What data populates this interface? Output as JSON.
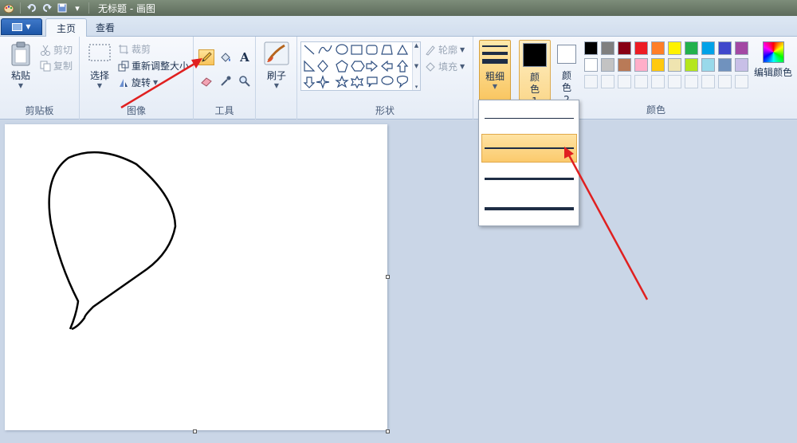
{
  "window": {
    "title": "无标题 - 画图"
  },
  "tabs": {
    "home": "主页",
    "view": "查看"
  },
  "ribbon": {
    "clipboard": {
      "label": "剪贴板",
      "paste": "粘贴",
      "cut": "剪切",
      "copy": "复制"
    },
    "image": {
      "label": "图像",
      "select": "选择",
      "crop": "裁剪",
      "resize": "重新调整大小",
      "rotate": "旋转"
    },
    "tools": {
      "label": "工具",
      "active": "pencil"
    },
    "brushes": {
      "label": "刷子"
    },
    "shapes": {
      "label": "形状",
      "outline": "轮廓",
      "fill": "填充"
    },
    "size": {
      "label": "粗细"
    },
    "colors": {
      "label": "颜色",
      "color1_label": "颜色 1",
      "color2_label": "颜色 2",
      "color1_value": "#000000",
      "color2_value": "#ffffff",
      "edit_label": "编辑颜色",
      "palette_row1": [
        "#000000",
        "#7f7f7f",
        "#880015",
        "#ed1c24",
        "#ff7f27",
        "#fff200",
        "#22b14c",
        "#00a2e8",
        "#3f48cc",
        "#a349a4"
      ],
      "palette_row2": [
        "#ffffff",
        "#c3c3c3",
        "#b97a57",
        "#ffaec9",
        "#ffc90e",
        "#efe4b0",
        "#b5e61d",
        "#99d9ea",
        "#7092be",
        "#c8bfe7"
      ]
    }
  },
  "size_dropdown": {
    "options": [
      1,
      3,
      5,
      8
    ],
    "selected_index": 1
  }
}
